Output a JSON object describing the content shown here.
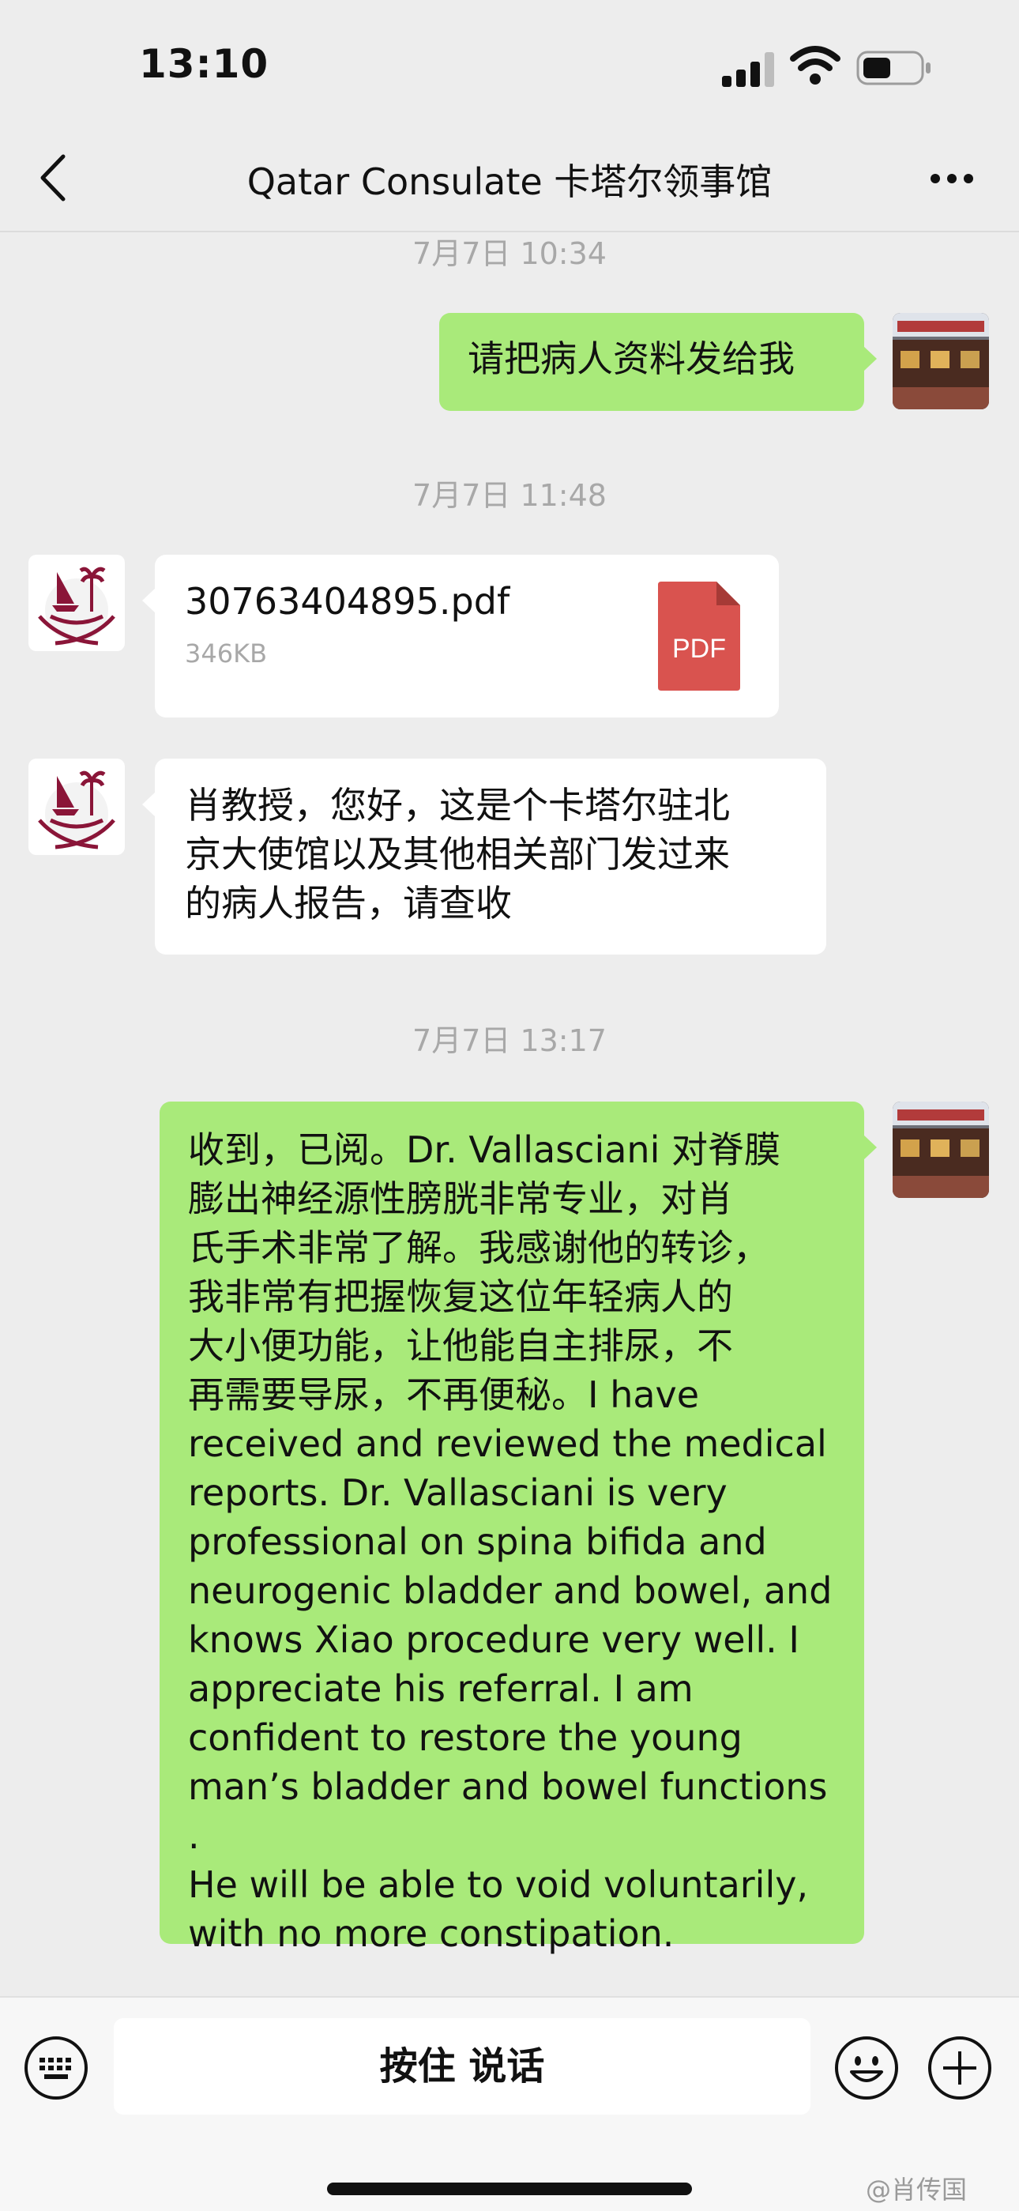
{
  "status_bar": {
    "time": "13:10"
  },
  "header": {
    "title": "Qatar Consulate 卡塔尔领事馆"
  },
  "messages": {
    "ts1": "7月7日 10:34",
    "m1_text": "请把病人资料发给我",
    "ts2": "7月7日 11:48",
    "file": {
      "name": "30763404895.pdf",
      "size": "346KB",
      "icon_label": "PDF"
    },
    "m3_lines": [
      "肖教授，您好，这是个卡塔尔驻北",
      "京大使馆以及其他相关部门发过来",
      "的病人报告，请查收"
    ],
    "ts3": "7月7日 13:17",
    "m4_lines": [
      "收到，已阅。Dr. Vallasciani 对脊膜",
      "膨出神经源性膀胱非常专业，对肖",
      "氏手术非常了解。我感谢他的转诊，",
      "我非常有把握恢复这位年轻病人的",
      "大小便功能，让他能自主排尿，不",
      "再需要导尿，不再便秘。I have",
      "received and reviewed the medical",
      "reports. Dr. Vallasciani is very",
      "professional on spina bifida and",
      "neurogenic bladder and bowel, and",
      "knows Xiao procedure very well. I",
      "appreciate his referral. I am",
      "confident to restore the young",
      "man’s bladder and bowel functions .",
      " He will be able to void voluntarily,",
      "with no more constipation."
    ]
  },
  "input_bar": {
    "hold_to_talk": "按住 说话"
  },
  "watermark": "@肖传国",
  "colors": {
    "background": "#EDEDED",
    "outgoing_bubble": "#A9EA7A",
    "incoming_bubble": "#FFFFFF",
    "pdf_red": "#D9534F",
    "qatar_maroon": "#8A1538"
  },
  "icons": [
    "back-arrow-icon",
    "more-dots-icon",
    "keyboard-icon",
    "emoji-icon",
    "plus-icon",
    "pdf-file-icon",
    "signal-icon",
    "wifi-icon",
    "battery-icon"
  ]
}
